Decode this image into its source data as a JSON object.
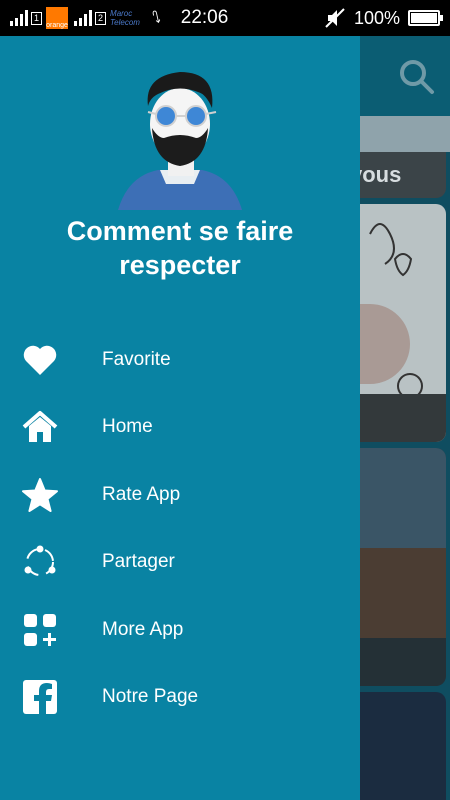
{
  "status_bar": {
    "sim1_slot": "1",
    "sim2_slot": "2",
    "operator1": "orange",
    "operator2_line1": "Maroc",
    "operator2_line2": "Telecom",
    "time": "22:06",
    "battery_text": "100%",
    "battery_level": 1.0
  },
  "background_app": {
    "card_title_partial": "vous",
    "toolbar_color": "#0b5d73"
  },
  "drawer": {
    "app_name": "Comment se faire respecter",
    "background_color": "#0983a3",
    "menu": [
      {
        "label": "Favorite",
        "icon": "heart-icon"
      },
      {
        "label": "Home",
        "icon": "home-icon"
      },
      {
        "label": "Rate App",
        "icon": "star-icon"
      },
      {
        "label": "Partager",
        "icon": "share-icon"
      },
      {
        "label": "More App",
        "icon": "apps-icon"
      },
      {
        "label": "Notre Page",
        "icon": "facebook-icon"
      }
    ]
  }
}
